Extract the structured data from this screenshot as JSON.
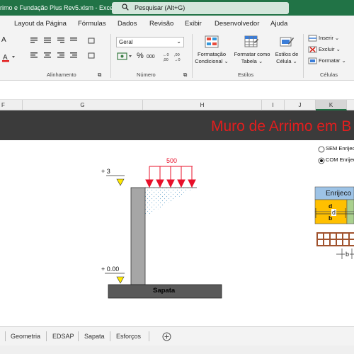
{
  "titlebar": {
    "file_name": "rimo e Fundação Plus Rev5.xlsm  -  Excel",
    "search_placeholder": "Pesquisar (Alt+G)"
  },
  "ribbon_tabs": [
    "Layout da Página",
    "Fórmulas",
    "Dados",
    "Revisão",
    "Exibir",
    "Desenvolvedor",
    "Ajuda"
  ],
  "ribbon": {
    "groups": {
      "alignment": "Alinhamento",
      "number": "Número",
      "styles": "Estilos",
      "cells": "Células"
    },
    "number_format": "Geral",
    "percent_symbol": "%",
    "thousands_symbol": "000",
    "conditional_formatting": [
      "Formatação",
      "Condicional"
    ],
    "format_as_table": [
      "Formatar como",
      "Tabela"
    ],
    "cell_styles": [
      "Estilos de",
      "Célula"
    ],
    "insert": "Inserir",
    "delete": "Excluir",
    "format": "Formatar"
  },
  "columns": [
    "F",
    "G",
    "H",
    "I",
    "J",
    "K"
  ],
  "banner_title": "Muro de Arrimo em B",
  "drawing": {
    "load_value": "500",
    "top_level": "+ 3",
    "base_level": "+ 0.00",
    "footing_label": "Sapata"
  },
  "options": {
    "without_stiffener": "SEM Enrijece",
    "with_stiffener": "COM Enrijec",
    "selected": "with_stiffener"
  },
  "stiffener_table": {
    "header": "Enrijeco",
    "rows": [
      "d",
      "b"
    ]
  },
  "detail_labels": {
    "d": "d",
    "b": "b"
  },
  "sheet_tabs": [
    "Geometria",
    "EDSAP",
    "Sapata",
    "Esforços"
  ],
  "colors": {
    "excel_green": "#217346",
    "banner_bg": "#3b3b3b",
    "banner_text": "#e21e1e",
    "table_header": "#9dc3e6",
    "table_cell": "#ffc000",
    "table_green": "#a9d08e",
    "brick": "#a0522d",
    "load_arrow": "#e8102a"
  }
}
